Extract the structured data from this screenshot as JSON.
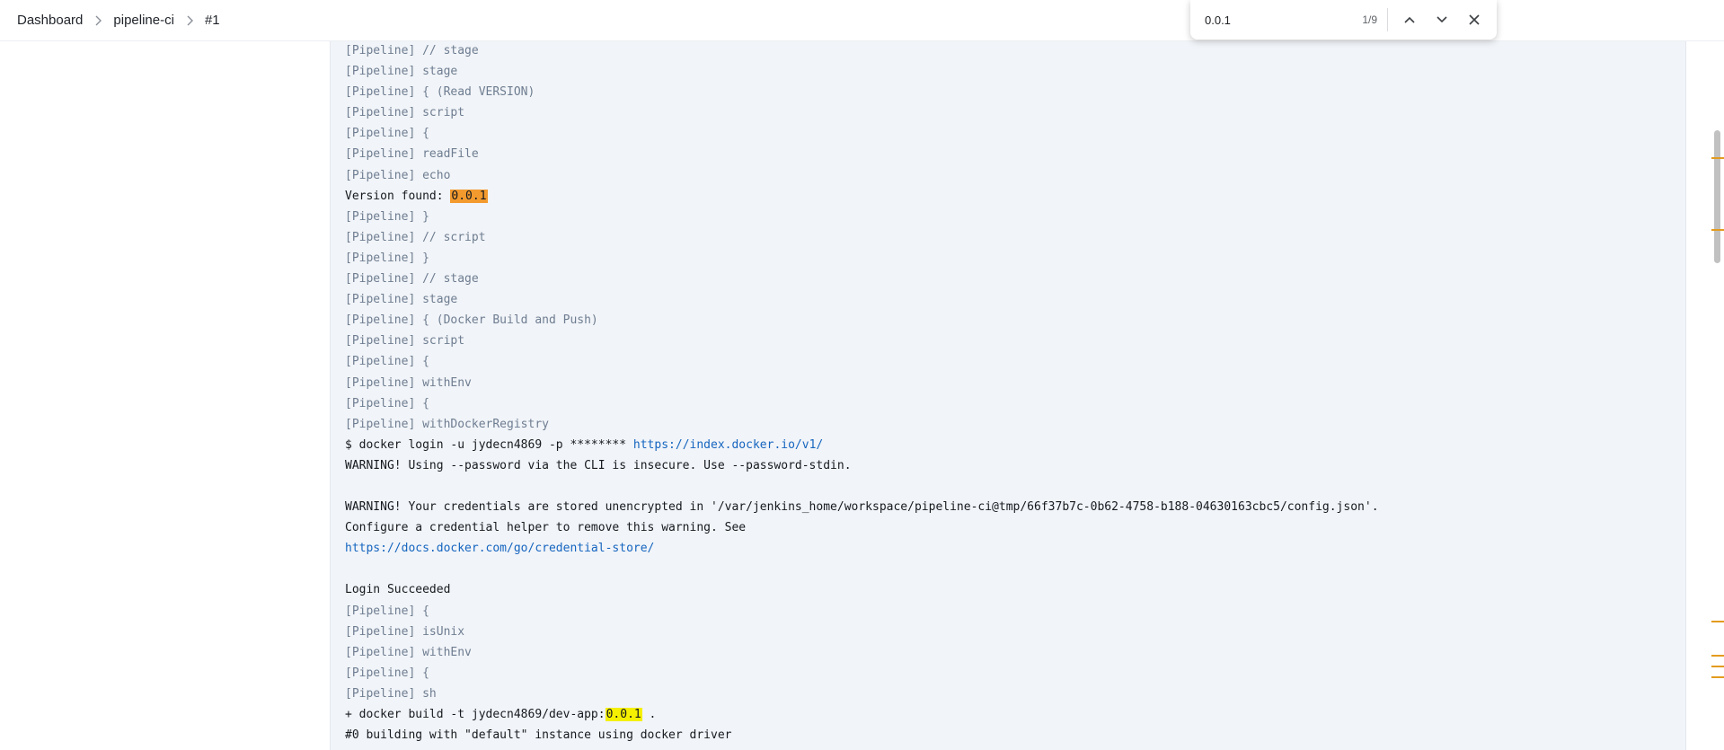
{
  "breadcrumb": {
    "items": [
      "Dashboard",
      "pipeline-ci",
      "#1"
    ]
  },
  "find_bar": {
    "query": "0.0.1",
    "count": "1/9",
    "prev_icon": "chevron-up-icon",
    "next_icon": "chevron-down-icon",
    "close_icon": "close-icon"
  },
  "console": {
    "lines": [
      {
        "type": "pipe",
        "text": "[Pipeline] // stage"
      },
      {
        "type": "pipe",
        "text": "[Pipeline] stage"
      },
      {
        "type": "pipe",
        "text": "[Pipeline] { (Read VERSION)"
      },
      {
        "type": "pipe",
        "text": "[Pipeline] script"
      },
      {
        "type": "pipe",
        "text": "[Pipeline] {"
      },
      {
        "type": "pipe",
        "text": "[Pipeline] readFile"
      },
      {
        "type": "pipe",
        "text": "[Pipeline] echo"
      },
      {
        "type": "plain",
        "parts": [
          {
            "text": "Version found: "
          },
          {
            "text": "0.0.1",
            "hl": "current"
          }
        ]
      },
      {
        "type": "pipe",
        "text": "[Pipeline] }"
      },
      {
        "type": "pipe",
        "text": "[Pipeline] // script"
      },
      {
        "type": "pipe",
        "text": "[Pipeline] }"
      },
      {
        "type": "pipe",
        "text": "[Pipeline] // stage"
      },
      {
        "type": "pipe",
        "text": "[Pipeline] stage"
      },
      {
        "type": "pipe",
        "text": "[Pipeline] { (Docker Build and Push)"
      },
      {
        "type": "pipe",
        "text": "[Pipeline] script"
      },
      {
        "type": "pipe",
        "text": "[Pipeline] {"
      },
      {
        "type": "pipe",
        "text": "[Pipeline] withEnv"
      },
      {
        "type": "pipe",
        "text": "[Pipeline] {"
      },
      {
        "type": "pipe",
        "text": "[Pipeline] withDockerRegistry"
      },
      {
        "type": "plain",
        "parts": [
          {
            "text": "$ docker login -u jydecn4869 -p ******** "
          },
          {
            "text": "https://index.docker.io/v1/",
            "link": true
          }
        ]
      },
      {
        "type": "plain",
        "text": "WARNING! Using --password via the CLI is insecure. Use --password-stdin."
      },
      {
        "type": "blank",
        "text": ""
      },
      {
        "type": "plain",
        "text": "WARNING! Your credentials are stored unencrypted in '/var/jenkins_home/workspace/pipeline-ci@tmp/66f37b7c-0b62-4758-b188-04630163cbc5/config.json'."
      },
      {
        "type": "plain",
        "text": "Configure a credential helper to remove this warning. See"
      },
      {
        "type": "plain",
        "parts": [
          {
            "text": "https://docs.docker.com/go/credential-store/",
            "link": true
          }
        ]
      },
      {
        "type": "blank",
        "text": ""
      },
      {
        "type": "plain",
        "text": "Login Succeeded"
      },
      {
        "type": "pipe",
        "text": "[Pipeline] {"
      },
      {
        "type": "pipe",
        "text": "[Pipeline] isUnix"
      },
      {
        "type": "pipe",
        "text": "[Pipeline] withEnv"
      },
      {
        "type": "pipe",
        "text": "[Pipeline] {"
      },
      {
        "type": "pipe",
        "text": "[Pipeline] sh"
      },
      {
        "type": "plain",
        "parts": [
          {
            "text": "+ docker build -t jydecn4869/dev-app:"
          },
          {
            "text": "0.0.1",
            "hl": "match"
          },
          {
            "text": " ."
          }
        ]
      },
      {
        "type": "plain",
        "text": "#0 building with \"default\" instance using docker driver"
      }
    ]
  },
  "colors": {
    "console_bg": "#f1f4f8",
    "pipeline_text": "#6e7d91",
    "link": "#1565c0",
    "match_highlight": "#f5ef00",
    "current_match_highlight": "#f39a2e",
    "scroll_marker": "#e39b1f"
  }
}
